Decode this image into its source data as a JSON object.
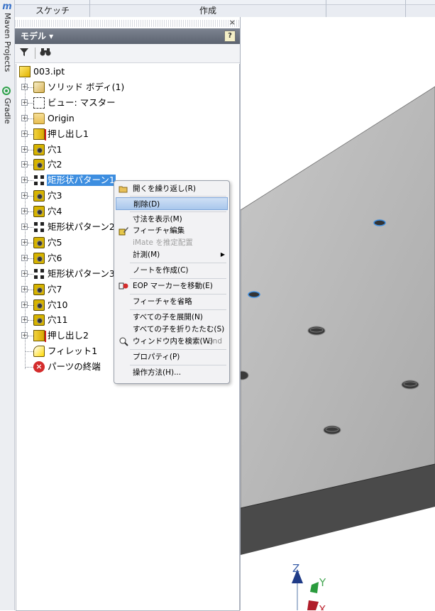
{
  "ribbon": {
    "tab_sketch": "スケッチ",
    "tab_create": "作成"
  },
  "side_strip": {
    "maven_label": "Maven Projects",
    "gradle_label": "Gradle",
    "logo": "m"
  },
  "panel": {
    "title": "モデル ▾",
    "help": "?",
    "close": "×",
    "tree": [
      {
        "label": "003.ipt",
        "icon": "part-icon"
      },
      {
        "label": "ソリッド ボディ(1)",
        "icon": "solid-body-icon"
      },
      {
        "label": "ビュー: マスター",
        "icon": "view-icon"
      },
      {
        "label": "Origin",
        "icon": "folder-icon"
      },
      {
        "label": "押し出し1",
        "icon": "extrude-icon"
      },
      {
        "label": "穴1",
        "icon": "hole-icon"
      },
      {
        "label": "穴2",
        "icon": "hole-icon"
      },
      {
        "label": "矩形状パターン1",
        "icon": "pattern-icon"
      },
      {
        "label": "穴3",
        "icon": "hole-icon"
      },
      {
        "label": "穴4",
        "icon": "hole-icon"
      },
      {
        "label": "矩形状パターン2",
        "icon": "pattern-icon"
      },
      {
        "label": "穴5",
        "icon": "hole-icon"
      },
      {
        "label": "穴6",
        "icon": "hole-icon"
      },
      {
        "label": "矩形状パターン3",
        "icon": "pattern-icon"
      },
      {
        "label": "穴7",
        "icon": "hole-icon"
      },
      {
        "label": "穴10",
        "icon": "hole-icon"
      },
      {
        "label": "穴11",
        "icon": "hole-icon"
      },
      {
        "label": "押し出し2",
        "icon": "extrude-icon"
      },
      {
        "label": "フィレット1",
        "icon": "fillet-icon"
      },
      {
        "label": "パーツの終端",
        "icon": "end-of-part-icon"
      }
    ]
  },
  "context_menu": {
    "repeat": "開くを繰り返し(R)",
    "delete": "削除(D)",
    "show_dims": "寸法を表示(M)",
    "edit_feature": "フィーチャ編集",
    "imate": "iMate を推定配置",
    "measure": "計測(M)",
    "create_note": "ノートを作成(C)",
    "move_eop": "EOP マーカーを移動(E)",
    "suppress": "フィーチャを省略",
    "expand_all": "すべての子を展開(N)",
    "collapse_all": "すべての子を折りたたむ(S)",
    "find_in_window": "ウィンドウ内を検索(W)",
    "find_shortcut": "End",
    "properties": "プロパティ(P)",
    "how_to": "操作方法(H)..."
  },
  "triad": {
    "z": "Z",
    "y": "Y",
    "x": "X"
  },
  "colors": {
    "selection": "#3d8ee0",
    "menu_highlight": "#a9c7ec",
    "model_face": "#b9b9b9"
  }
}
